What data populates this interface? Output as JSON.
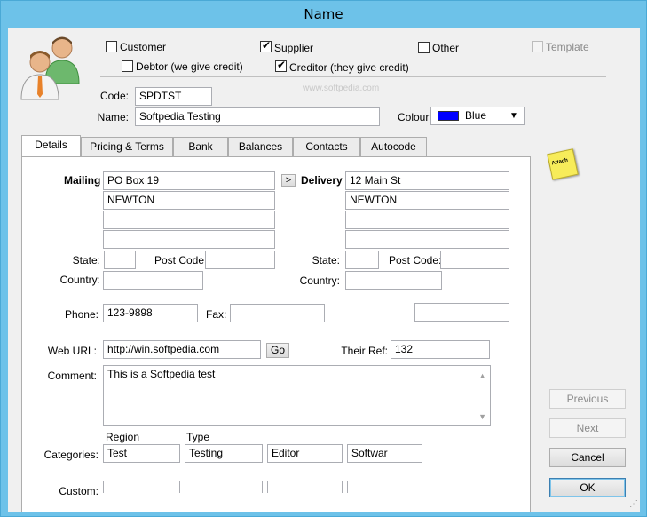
{
  "window": {
    "title": "Name"
  },
  "flags": {
    "customer": {
      "label": "Customer",
      "checked": false
    },
    "supplier": {
      "label": "Supplier",
      "checked": true
    },
    "other": {
      "label": "Other",
      "checked": false
    },
    "template": {
      "label": "Template",
      "checked": false
    },
    "debtor": {
      "label": "Debtor (we give credit)",
      "checked": false
    },
    "creditor": {
      "label": "Creditor (they give credit)",
      "checked": true
    }
  },
  "watermark": "www.softpedia.com",
  "code": {
    "label": "Code:",
    "value": "SPDTST"
  },
  "name": {
    "label": "Name:",
    "value": "Softpedia Testing"
  },
  "colour": {
    "label": "Colour:",
    "value": "Blue",
    "swatch": "#0000ff"
  },
  "tabs": [
    "Details",
    "Pricing & Terms",
    "Bank",
    "Balances",
    "Contacts",
    "Autocode"
  ],
  "details": {
    "mailing_label": "Mailing",
    "delivery_label": "Delivery",
    "copy_button": ">",
    "mailing": [
      "PO Box 19",
      "NEWTON",
      "",
      ""
    ],
    "delivery": [
      "12 Main St",
      "NEWTON",
      "",
      ""
    ],
    "state_label": "State:",
    "postcode_label": "Post Code:",
    "country_label": "Country:",
    "mailing_state": "",
    "mailing_postcode": "",
    "mailing_country": "",
    "delivery_state": "",
    "delivery_postcode": "",
    "delivery_country": "",
    "phone_label": "Phone:",
    "phone": "123-9898",
    "fax_label": "Fax:",
    "fax": "",
    "extra_phone": "",
    "weburl_label": "Web URL:",
    "weburl": "http://win.softpedia.com",
    "go_button": "Go",
    "theirref_label": "Their Ref:",
    "theirref": "132",
    "comment_label": "Comment:",
    "comment": "This is a Softpedia test",
    "categories_label": "Categories:",
    "categories_headers": [
      "Region",
      "Type"
    ],
    "categories": [
      "Test",
      "Testing",
      "Editor",
      "Softwar"
    ],
    "custom_label": "Custom:"
  },
  "note_icon_text": "Attach",
  "buttons": {
    "previous": "Previous",
    "next": "Next",
    "cancel": "Cancel",
    "ok": "OK"
  }
}
